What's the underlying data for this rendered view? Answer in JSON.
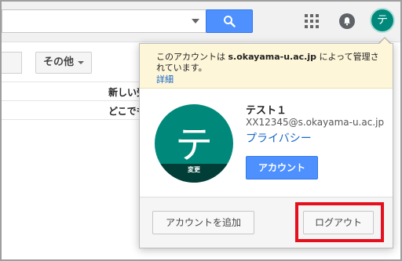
{
  "topbar": {
    "search_value": "",
    "apps_icon": "apps-grid-icon",
    "notifications_icon": "bell-icon",
    "avatar_initial": "テ"
  },
  "toolbar": {
    "more_label": "その他"
  },
  "list": {
    "rows": [
      {
        "snippet": "新しい受"
      },
      {
        "snippet": "どこでも"
      }
    ]
  },
  "popup": {
    "notice": {
      "prefix": "このアカウントは ",
      "domain": "s.okayama-u.ac.jp",
      "suffix": " によって管理されています。",
      "details_link": "詳細"
    },
    "avatar_initial": "テ",
    "avatar_change_label": "変更",
    "user_name": "テスト１",
    "user_email": "XX12345@s.okayama-u.ac.jp",
    "privacy_link": "プライバシー",
    "account_button": "アカウント",
    "add_account_button": "アカウントを追加",
    "logout_button": "ログアウト"
  },
  "colors": {
    "accent_blue": "#4d90fe",
    "avatar_teal": "#00897b",
    "notice_bg": "#fdf6d9",
    "highlight_red": "#e4101d",
    "link_blue": "#1a66c9"
  }
}
